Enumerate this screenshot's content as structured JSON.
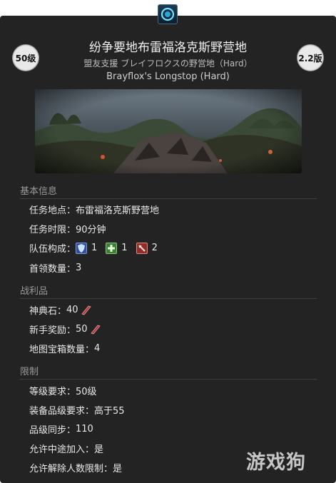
{
  "duty": {
    "level_badge": "50级",
    "version_badge": "2.2版",
    "title_cn": "纷争要地布雷福洛克斯野营地",
    "title_jp": "盟友支援 ブレイフロクスの野営地（Hard）",
    "title_en": "Brayflox's Longstop (Hard)"
  },
  "basic": {
    "heading": "基本信息",
    "location_label": "任务地点：",
    "location_value": "布雷福洛克斯野营地",
    "time_label": "任务时限：",
    "time_value": "90分钟",
    "party_label": "队伍构成：",
    "party": [
      {
        "role": "tank",
        "icon": "shield-icon",
        "count": "1",
        "color": "#3b5fb0"
      },
      {
        "role": "healer",
        "icon": "plus-icon",
        "count": "1",
        "color": "#3f8f3a"
      },
      {
        "role": "dps",
        "icon": "sword-icon",
        "count": "2",
        "color": "#a33a32"
      }
    ],
    "boss_label": "首领数量：",
    "boss_value": "3"
  },
  "loot": {
    "heading": "战利品",
    "tomestone_label": "神典石：",
    "tomestone_value": "40",
    "rookie_label": "新手奖励：",
    "rookie_value": "50",
    "chest_label": "地图宝箱数量：",
    "chest_value": "4"
  },
  "restrict": {
    "heading": "限制",
    "level_label": "等级要求：",
    "level_value": "50级",
    "ilvl_label": "装备品级要求：",
    "ilvl_value": "高于55",
    "sync_label": "品级同步：",
    "sync_value": "110",
    "join_label": "允许中途加入：",
    "join_value": "是",
    "release_label": "允许解除人数限制：",
    "release_value": "是"
  },
  "watermark": {
    "text": "游戏狗"
  }
}
